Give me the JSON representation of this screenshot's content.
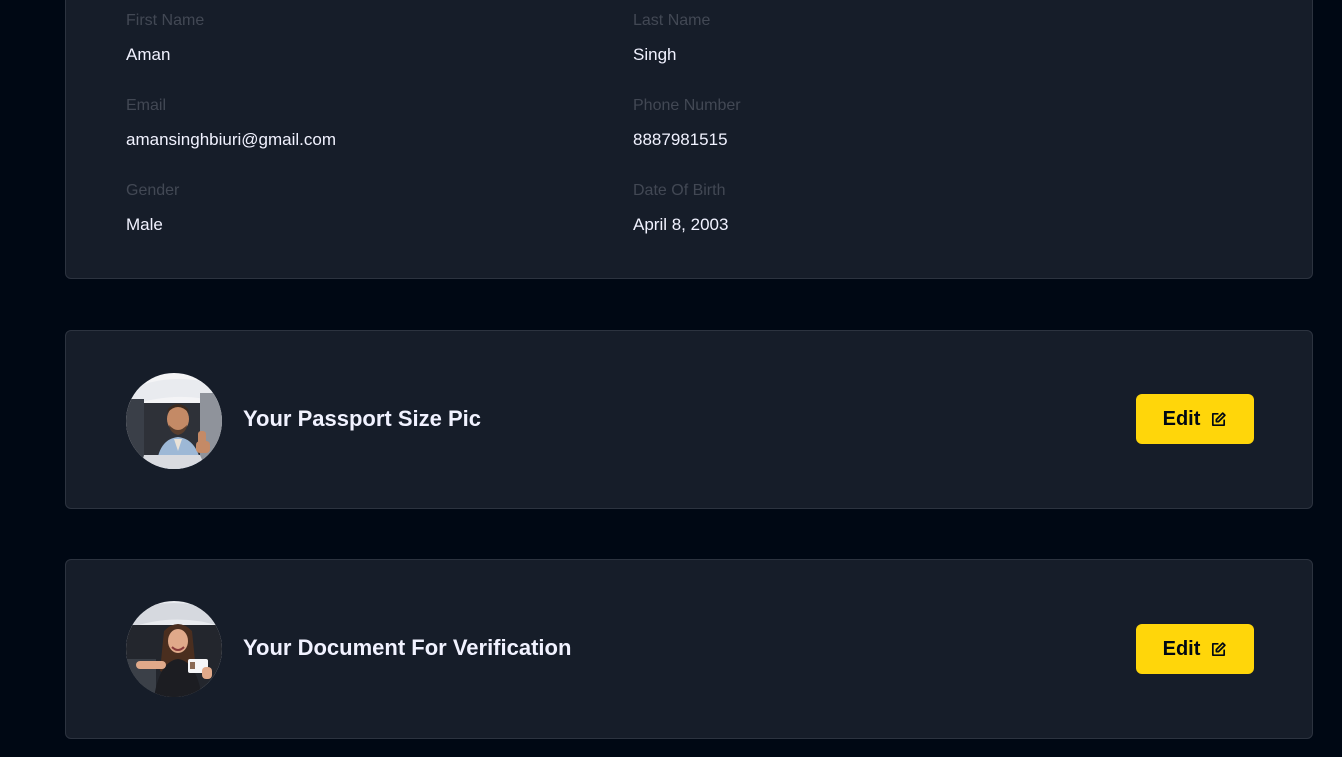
{
  "profile_details": {
    "first_name": {
      "label": "First Name",
      "value": "Aman"
    },
    "last_name": {
      "label": "Last Name",
      "value": "Singh"
    },
    "email": {
      "label": "Email",
      "value": "amansinghbiuri@gmail.com"
    },
    "phone": {
      "label": "Phone Number",
      "value": "8887981515"
    },
    "gender": {
      "label": "Gender",
      "value": "Male"
    },
    "dob": {
      "label": "Date Of Birth",
      "value": "April 8, 2003"
    }
  },
  "uploads": [
    {
      "title": "Your Passport Size Pic",
      "edit_label": "Edit",
      "icon": "edit-icon"
    },
    {
      "title": "Your Document For Verification",
      "edit_label": "Edit",
      "icon": "edit-icon"
    }
  ],
  "colors": {
    "page_background": "#000814",
    "card_background": "#161d29",
    "card_border": "#2c333f",
    "label_text": "#424854",
    "value_text": "#f1f2ff",
    "accent_button": "#ffd60a"
  }
}
